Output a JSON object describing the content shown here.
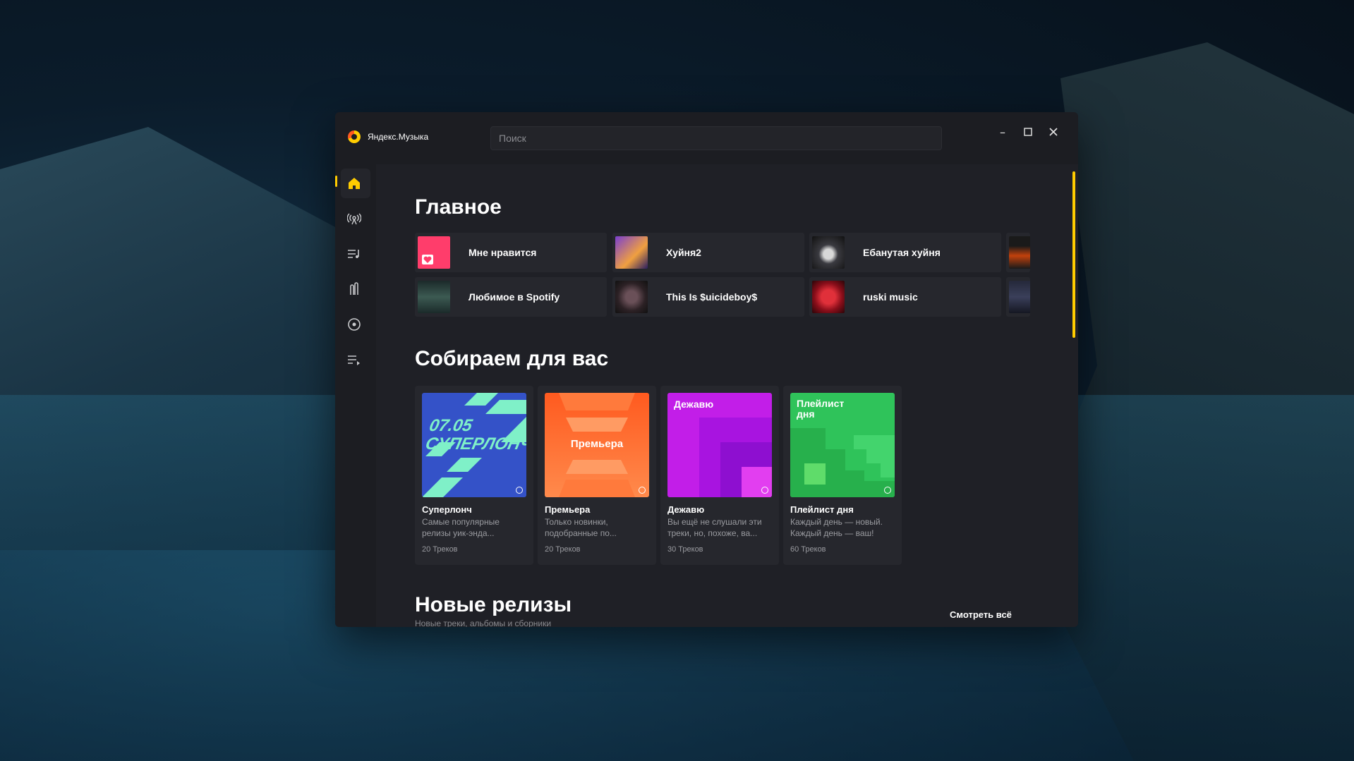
{
  "window": {
    "app_title": "Яндекс.Музыка",
    "search_placeholder": "Поиск"
  },
  "sidebar": {
    "items": [
      {
        "icon": "home-icon",
        "active": true
      },
      {
        "icon": "radio-icon"
      },
      {
        "icon": "playlist-icon"
      },
      {
        "icon": "podcast-icon"
      },
      {
        "icon": "disc-icon"
      },
      {
        "icon": "queue-icon"
      }
    ]
  },
  "main": {
    "title": "Главное",
    "quick": [
      {
        "label": "Мне нравится",
        "cover": "#ff3d6b"
      },
      {
        "label": "Хуйня2",
        "cover": "#6b3fbf"
      },
      {
        "label": "Ебанутая хуйня",
        "cover": "#3a3a40"
      },
      {
        "label": "",
        "cover": "#c2410c"
      },
      {
        "label": "Любимое в Spotify",
        "cover": "#2f4a42"
      },
      {
        "label": "This Is $uicideboy$",
        "cover": "#2c2125"
      },
      {
        "label": "ruski music",
        "cover": "#8a0e1a"
      },
      {
        "label": "",
        "cover": "#25283a"
      }
    ]
  },
  "for_you": {
    "title": "Собираем для вас",
    "playlists": [
      {
        "name": "Суперлонч",
        "desc": "Самые популярные релизы уик-энда...",
        "count": "20 Треков",
        "cover_text": "07.05 СУПЕРЛОНЧ",
        "bg": "#3452c8"
      },
      {
        "name": "Премьера",
        "desc": "Только новинки, подобранные по...",
        "count": "20 Треков",
        "cover_text": "Премьера",
        "bg": "#ff6a2c"
      },
      {
        "name": "Дежавю",
        "desc": "Вы ещё не слушали эти треки, но, похоже, ва...",
        "count": "30 Треков",
        "cover_text": "Дежавю",
        "bg": "#c21ee8"
      },
      {
        "name": "Плейлист дня",
        "desc": "Каждый день — новый. Каждый день — ваш!",
        "count": "60 Треков",
        "cover_text": "Плейлист дня",
        "bg": "#2fc35a"
      }
    ]
  },
  "new_releases": {
    "title": "Новые релизы",
    "subtitle": "Новые треки, альбомы и сборники",
    "see_all": "Смотреть всё"
  }
}
